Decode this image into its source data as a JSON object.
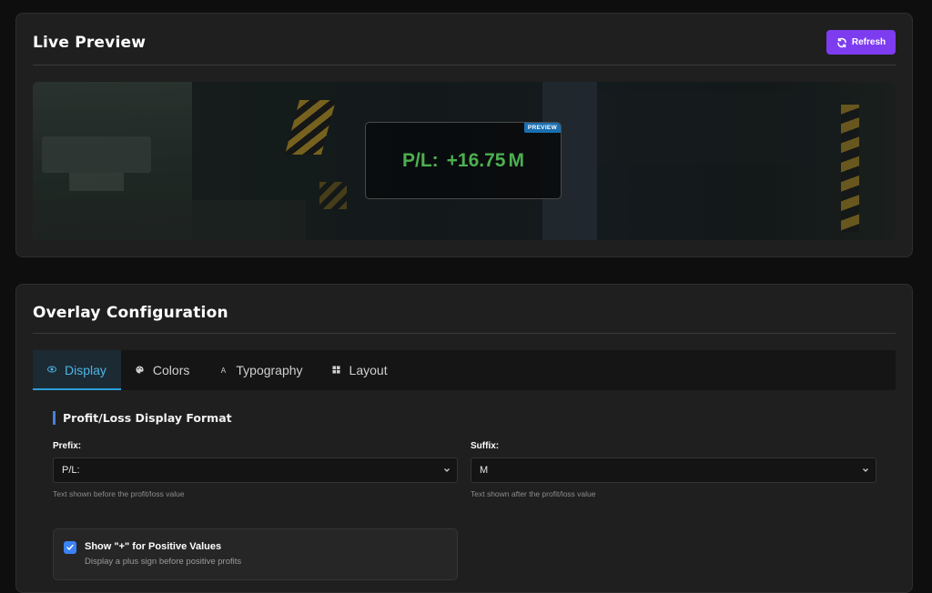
{
  "preview_card": {
    "title": "Live Preview",
    "refresh_label": "Refresh",
    "overlay": {
      "badge": "PREVIEW",
      "prefix": "P/L:",
      "value": "+16.75",
      "suffix": "M",
      "value_color": "#4caf50"
    }
  },
  "config_card": {
    "title": "Overlay Configuration",
    "tabs": [
      {
        "label": "Display",
        "icon": "eye-icon",
        "active": true
      },
      {
        "label": "Colors",
        "icon": "palette-icon",
        "active": false
      },
      {
        "label": "Typography",
        "icon": "font-icon",
        "active": false
      },
      {
        "label": "Layout",
        "icon": "grid-icon",
        "active": false
      }
    ],
    "section_title": "Profit/Loss Display Format",
    "prefix_field": {
      "label": "Prefix:",
      "value": "P/L:",
      "help": "Text shown before the profit/loss value"
    },
    "suffix_field": {
      "label": "Suffix:",
      "value": "M",
      "help": "Text shown after the profit/loss value"
    },
    "show_plus_option": {
      "title": "Show \"+\" for Positive Values",
      "description": "Display a plus sign before positive profits",
      "checked": true
    }
  },
  "colors": {
    "accent_button": "#7d3cf0",
    "active_tab": "#4fb6e8",
    "profit_green": "#4caf50",
    "checkbox_blue": "#3b82f6",
    "section_bar": "#4a7fd8"
  }
}
